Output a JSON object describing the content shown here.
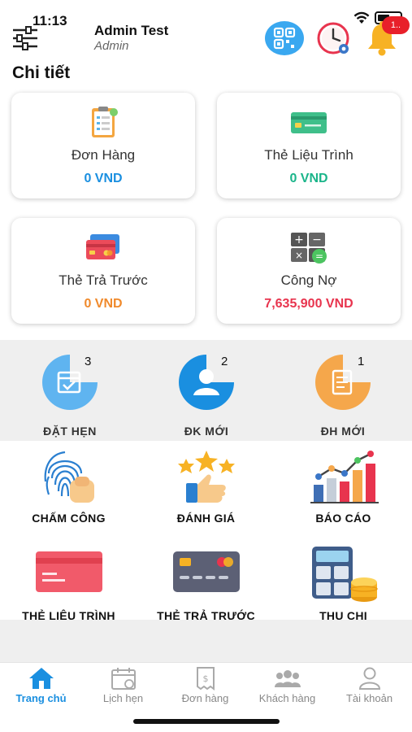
{
  "status": {
    "time": "11:13"
  },
  "header": {
    "user_name": "Admin Test",
    "user_role": "Admin",
    "notification_badge": "1.."
  },
  "section_title": "Chi tiết",
  "cards": [
    {
      "label": "Đơn Hàng",
      "value": "0 VND",
      "color": "#1a8fe0",
      "icon": "clipboard-icon"
    },
    {
      "label": "Thẻ Liệu Trình",
      "value": "0 VND",
      "color": "#1bb58a",
      "icon": "green-card-icon"
    },
    {
      "label": "Thẻ Trả Trước",
      "value": "0 VND",
      "color": "#f08a2c",
      "icon": "credit-cards-icon"
    },
    {
      "label": "Công Nợ",
      "value": "7,635,900 VND",
      "color": "#e8344e",
      "icon": "calculator-icon"
    }
  ],
  "stats": [
    {
      "label": "ĐẶT HẸN",
      "count": "3",
      "color": "#5fb4f0",
      "icon": "calendar-icon"
    },
    {
      "label": "ĐK MỚI",
      "count": "2",
      "color": "#1a8fe0",
      "icon": "person-icon"
    },
    {
      "label": "ĐH MỚI",
      "count": "1",
      "color": "#f5a74b",
      "icon": "receipt-icon"
    }
  ],
  "features": [
    {
      "label": "CHẤM CÔNG",
      "icon": "fingerprint-icon"
    },
    {
      "label": "ĐÁNH GIÁ",
      "icon": "thumbs-up-stars-icon"
    },
    {
      "label": "BÁO CÁO",
      "icon": "bar-chart-icon"
    },
    {
      "label": "THẺ LIỆU TRÌNH",
      "icon": "red-card-icon"
    },
    {
      "label": "THẺ TRẢ TRƯỚC",
      "icon": "dark-card-icon"
    },
    {
      "label": "THU CHI",
      "icon": "calculator-coins-icon"
    }
  ],
  "tabs": [
    {
      "label": "Trang chủ",
      "icon": "home-icon",
      "active": true
    },
    {
      "label": "Lịch hẹn",
      "icon": "calendar-icon"
    },
    {
      "label": "Đơn hàng",
      "icon": "receipt-icon"
    },
    {
      "label": "Khách hàng",
      "icon": "users-icon"
    },
    {
      "label": "Tài khoản",
      "icon": "account-icon"
    }
  ],
  "colors": {
    "accent": "#1a8fe0",
    "tab_inactive": "#888888",
    "section_bg": "#efefef"
  }
}
